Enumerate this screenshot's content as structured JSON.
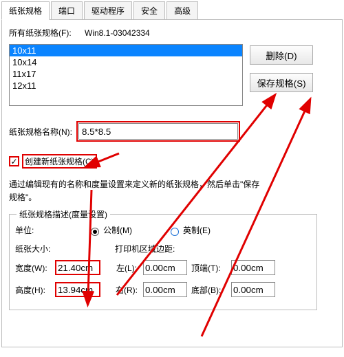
{
  "tabs": {
    "t0": "纸张规格",
    "t1": "端口",
    "t2": "驱动程序",
    "t3": "安全",
    "t4": "高级"
  },
  "all_forms_label": "所有纸张规格(F):",
  "all_forms_value": "Win8.1-03042334",
  "list": {
    "o0": "10x11",
    "o1": "10x14",
    "o2": "11x17",
    "o3": "12x11"
  },
  "buttons": {
    "del": "删除(D)",
    "save": "保存规格(S)"
  },
  "name_label": "纸张规格名称(N):",
  "name_value": "8.5*8.5",
  "create_new_label": "创建新纸张规格(C)",
  "description": "通过编辑现有的名称和度量设置来定义新的纸张规格，然后单击\"保存规格\"。",
  "fs_title": "纸张规格描述(度量设置)",
  "units_label": "单位:",
  "radio_metric": "公制(M)",
  "radio_english": "英制(E)",
  "paper_size_label": "纸张大小:",
  "print_area_label": "打印机区域边距:",
  "width_label": "宽度(W):",
  "width_value": "21.40cm",
  "height_label": "高度(H):",
  "height_value": "13.94cm",
  "left_label": "左(L):",
  "left_value": "0.00cm",
  "right_label": "右(R):",
  "right_value": "0.00cm",
  "top_label": "顶端(T):",
  "top_value": "0.00cm",
  "bottom_label": "底部(B):",
  "bottom_value": "0.00cm"
}
